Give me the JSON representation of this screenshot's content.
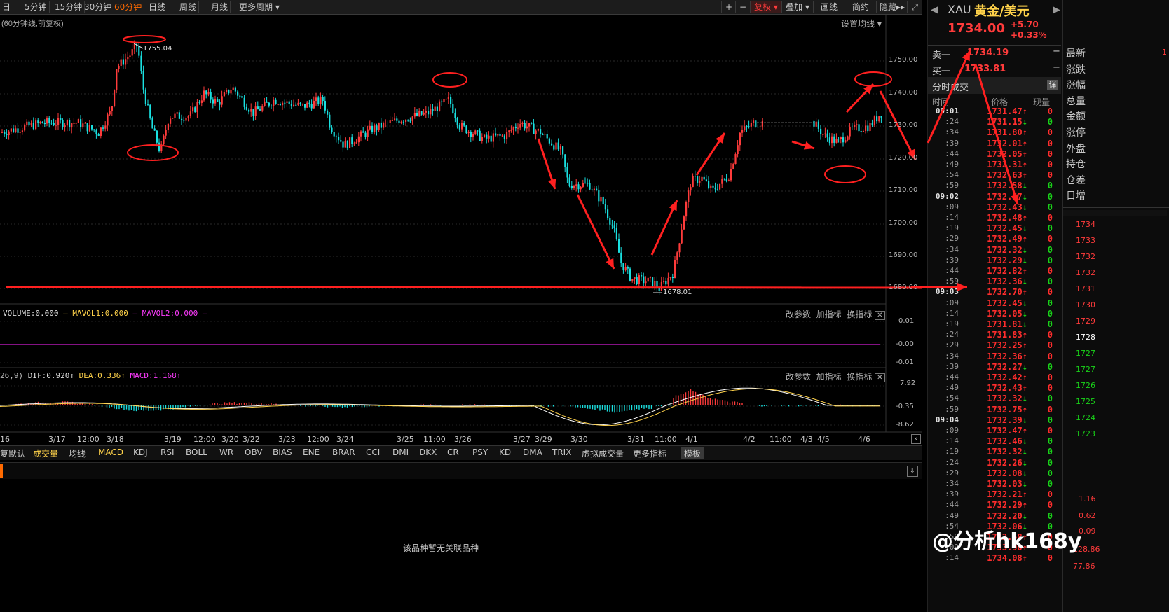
{
  "toolbar": {
    "periods": [
      "日",
      "5分钟",
      "15分钟",
      "30分钟",
      "60分钟",
      "日线",
      "周线",
      "月线",
      "更多周期"
    ],
    "active_period": "60分钟",
    "right_buttons": [
      "+",
      "−",
      "复权",
      "叠加",
      "画线",
      "简约",
      "隐藏▸▸",
      "⤢"
    ]
  },
  "main": {
    "subtitle": "(60分钟线,前复权)",
    "ma_setting": "设置均线",
    "high_label": "1755.04",
    "low_label": "1678.01",
    "y_ticks": [
      "1750.00",
      "1740.00",
      "1730.00",
      "1720.00",
      "1710.00",
      "1700.00",
      "1690.00",
      "1680.00"
    ]
  },
  "volume_panel": {
    "title_volume": "VOLUME:0.000",
    "title_mavol1": "MAVOL1:0.000",
    "title_mavol2": "MAVOL2:0.000",
    "tools": [
      "改参数",
      "加指标",
      "换指标"
    ],
    "y_ticks": [
      "0.01",
      "-0.00",
      "-0.01"
    ]
  },
  "macd_panel": {
    "params": "26,9)",
    "dif": "DIF:0.920",
    "dea": "DEA:0.336",
    "macd": "MACD:1.168",
    "tools": [
      "改参数",
      "加指标",
      "换指标"
    ],
    "y_ticks": [
      "7.92",
      "-0.35",
      "-8.62"
    ]
  },
  "x_ticks": [
    "16",
    "3/17",
    "12:00",
    "3/18",
    "3/19",
    "12:00",
    "3/20",
    "3/22",
    "3/23",
    "12:00",
    "3/24",
    "3/25",
    "11:00",
    "3/26",
    "3/27",
    "3/29",
    "3/30",
    "3/31",
    "11:00",
    "4/1",
    "4/2",
    "11:00",
    "4/3",
    "4/5",
    "4/6"
  ],
  "indicator_tabs": [
    "复默认",
    "成交量",
    "均线",
    "MACD",
    "KDJ",
    "RSI",
    "BOLL",
    "WR",
    "OBV",
    "BIAS",
    "ENE",
    "BRAR",
    "CCI",
    "DMI",
    "DKX",
    "CR",
    "PSY",
    "KD",
    "DMA",
    "TRIX",
    "虚拟成交量",
    "更多指标",
    "模板"
  ],
  "bottom_message": "该品种暂无关联品种",
  "quote": {
    "code": "XAU",
    "name": "黄金/美元",
    "price": "1734.00",
    "change": "+5.70",
    "change_pct": "+0.33%",
    "sell_label": "卖一",
    "sell_price": "1734.19",
    "buy_label": "买一",
    "buy_price": "1733.81",
    "trades_title": "分时成交",
    "detail_btn": "详",
    "col_time": "时间",
    "col_price": "价格",
    "col_vol": "现量"
  },
  "trades": [
    {
      "t": "09:01",
      "p": "1731.47",
      "d": "up",
      "v": "0",
      "major": true
    },
    {
      "t": ":24",
      "p": "1731.15",
      "d": "dn",
      "v": "0"
    },
    {
      "t": ":34",
      "p": "1731.80",
      "d": "up",
      "v": "0"
    },
    {
      "t": ":39",
      "p": "1732.01",
      "d": "up",
      "v": "0"
    },
    {
      "t": ":44",
      "p": "1732.05",
      "d": "up",
      "v": "0"
    },
    {
      "t": ":49",
      "p": "1732.31",
      "d": "up",
      "v": "0"
    },
    {
      "t": ":54",
      "p": "1732.63",
      "d": "up",
      "v": "0"
    },
    {
      "t": ":59",
      "p": "1732.58",
      "d": "dn",
      "v": "0"
    },
    {
      "t": "09:02",
      "p": "1732.57",
      "d": "dn",
      "v": "0",
      "major": true
    },
    {
      "t": ":09",
      "p": "1732.43",
      "d": "dn",
      "v": "0"
    },
    {
      "t": ":14",
      "p": "1732.48",
      "d": "up",
      "v": "0"
    },
    {
      "t": ":19",
      "p": "1732.45",
      "d": "dn",
      "v": "0"
    },
    {
      "t": ":29",
      "p": "1732.49",
      "d": "up",
      "v": "0"
    },
    {
      "t": ":34",
      "p": "1732.32",
      "d": "dn",
      "v": "0"
    },
    {
      "t": ":39",
      "p": "1732.29",
      "d": "dn",
      "v": "0"
    },
    {
      "t": ":44",
      "p": "1732.82",
      "d": "up",
      "v": "0"
    },
    {
      "t": ":59",
      "p": "1732.36",
      "d": "dn",
      "v": "0"
    },
    {
      "t": "09:03",
      "p": "1732.70",
      "d": "up",
      "v": "0",
      "major": true
    },
    {
      "t": ":09",
      "p": "1732.45",
      "d": "dn",
      "v": "0"
    },
    {
      "t": ":14",
      "p": "1732.05",
      "d": "dn",
      "v": "0"
    },
    {
      "t": ":19",
      "p": "1731.81",
      "d": "dn",
      "v": "0"
    },
    {
      "t": ":24",
      "p": "1731.83",
      "d": "up",
      "v": "0"
    },
    {
      "t": ":29",
      "p": "1732.25",
      "d": "up",
      "v": "0"
    },
    {
      "t": ":34",
      "p": "1732.36",
      "d": "up",
      "v": "0"
    },
    {
      "t": ":39",
      "p": "1732.27",
      "d": "dn",
      "v": "0"
    },
    {
      "t": ":44",
      "p": "1732.42",
      "d": "up",
      "v": "0"
    },
    {
      "t": ":49",
      "p": "1732.43",
      "d": "up",
      "v": "0"
    },
    {
      "t": ":54",
      "p": "1732.32",
      "d": "dn",
      "v": "0"
    },
    {
      "t": ":59",
      "p": "1732.75",
      "d": "up",
      "v": "0"
    },
    {
      "t": "09:04",
      "p": "1732.39",
      "d": "dn",
      "v": "0",
      "major": true
    },
    {
      "t": ":09",
      "p": "1732.47",
      "d": "up",
      "v": "0"
    },
    {
      "t": ":14",
      "p": "1732.46",
      "d": "dn",
      "v": "0"
    },
    {
      "t": ":19",
      "p": "1732.32",
      "d": "dn",
      "v": "0"
    },
    {
      "t": ":24",
      "p": "1732.26",
      "d": "dn",
      "v": "0"
    },
    {
      "t": ":29",
      "p": "1732.08",
      "d": "dn",
      "v": "0"
    },
    {
      "t": ":34",
      "p": "1732.03",
      "d": "dn",
      "v": "0"
    },
    {
      "t": ":39",
      "p": "1732.21",
      "d": "up",
      "v": "0"
    },
    {
      "t": ":44",
      "p": "1732.29",
      "d": "up",
      "v": "0"
    },
    {
      "t": ":49",
      "p": "1732.20",
      "d": "dn",
      "v": "0"
    },
    {
      "t": ":54",
      "p": "1732.06",
      "d": "dn",
      "v": "0"
    },
    {
      "t": ":59",
      "p": "1732.58",
      "d": "up",
      "v": "0"
    },
    {
      "t": ":09",
      "p": "1733.90",
      "d": "up",
      "v": "0"
    },
    {
      "t": ":14",
      "p": "1734.08",
      "d": "up",
      "v": "0"
    }
  ],
  "far_right": {
    "labels": [
      "最新",
      "涨跌",
      "涨幅",
      "总量",
      "金额",
      "涨停",
      "外盘",
      "持仓",
      "仓差",
      "日增"
    ],
    "latest_partial": "1",
    "scale": [
      "1734",
      "1733",
      "1732",
      "1732",
      "1731",
      "1730",
      "1729",
      "1728",
      "1727",
      "1727",
      "1726",
      "1725",
      "1724",
      "1723"
    ],
    "bottom_vals": [
      "1.16",
      "0.62",
      "0.09",
      "128.86",
      "77.86"
    ]
  },
  "watermark": "@分析hk168y"
}
